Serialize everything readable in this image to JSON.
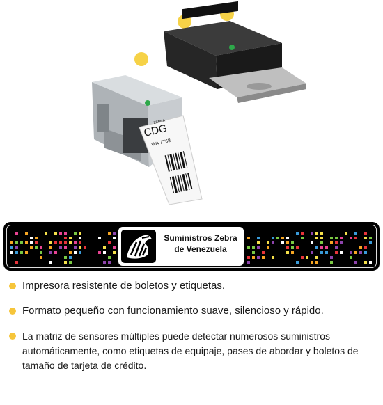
{
  "ticket": {
    "brand": "ZEBRA",
    "code": "CDG",
    "flight": "WA 7768"
  },
  "banner": {
    "company_line1": "Suministros Zebra",
    "company_line2": "de Venezuela"
  },
  "features": [
    "Impresora resistente de boletos y etiquetas.",
    "Formato pequeño con funcionamiento suave, silencioso y rápido.",
    "La matriz de sensores múltiples puede detectar numerosos suministros automáticamente, como etiquetas de equipaje, pases de abordar y boletos de tamaño de tarjeta de crédito."
  ],
  "colors": {
    "accent_dot": "#f6d247",
    "banner_bg": "#000000",
    "pixel_palette": [
      "#e8343a",
      "#f6a623",
      "#f5e04a",
      "#7ac943",
      "#3a9bd9",
      "#8e44ad",
      "#e84393",
      "#ffffff"
    ]
  }
}
